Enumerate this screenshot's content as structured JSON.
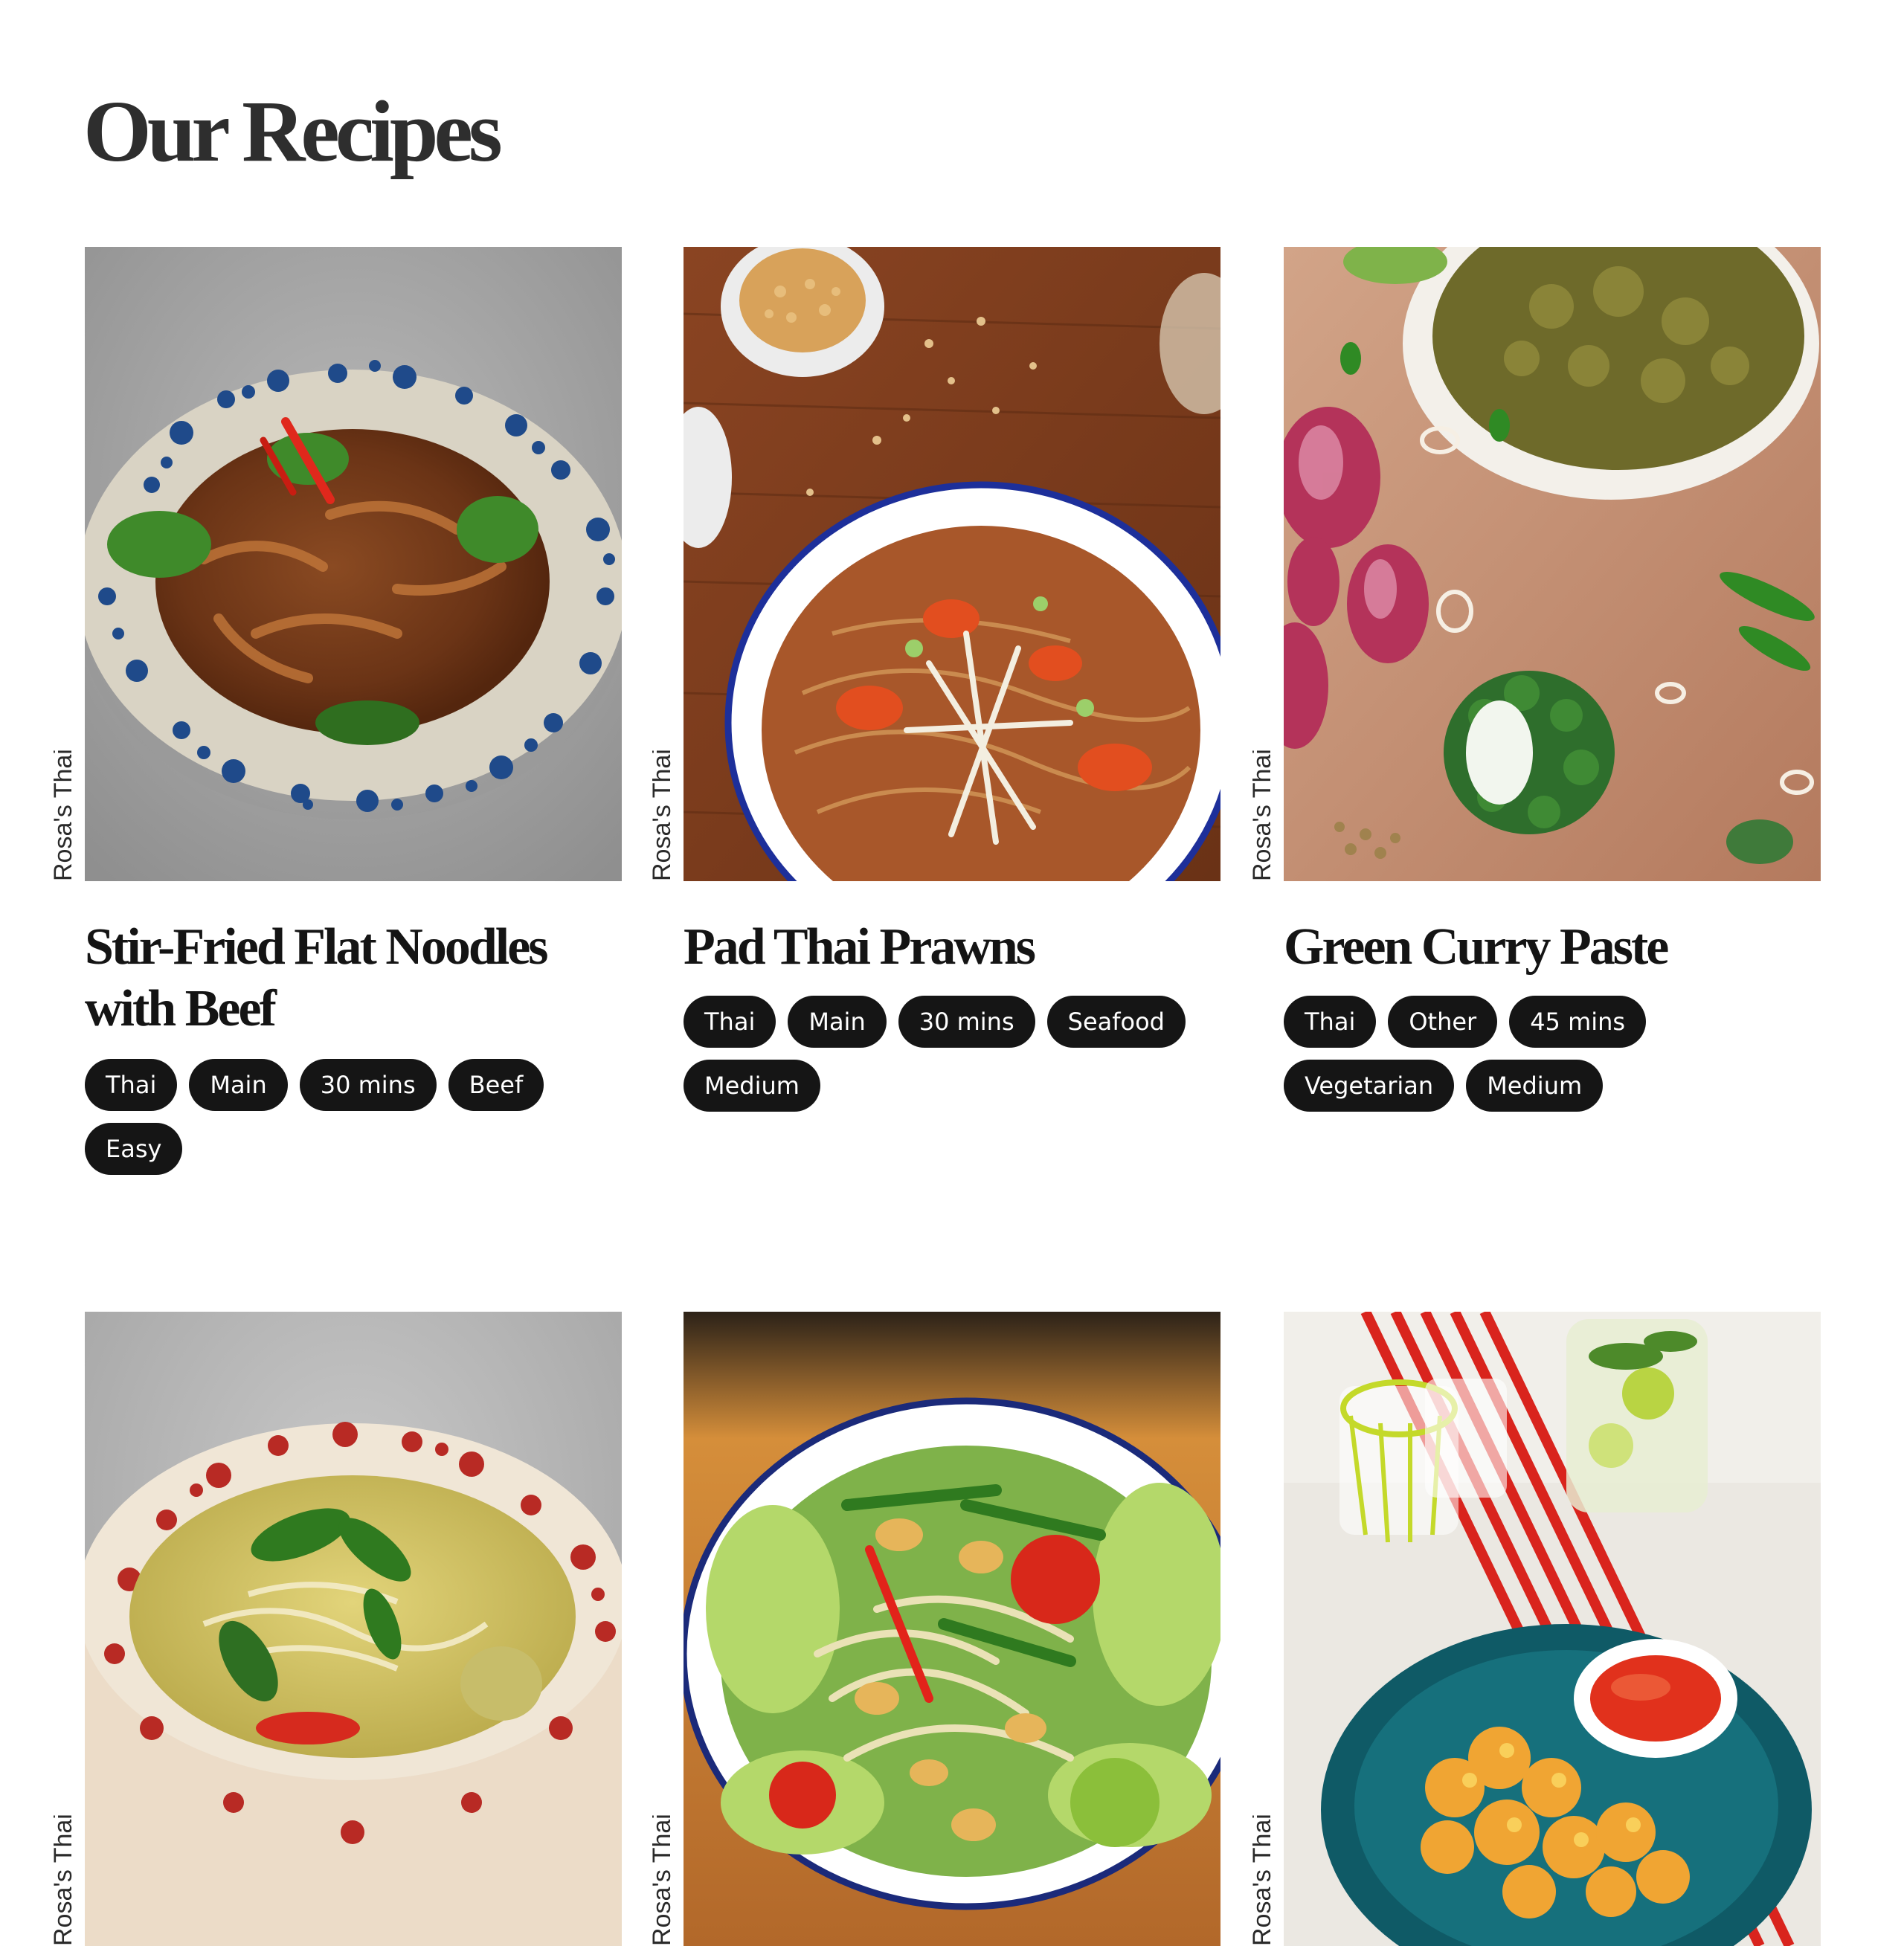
{
  "page": {
    "title": "Our Recipes"
  },
  "recipes": [
    {
      "brand": "Rosa's Thai",
      "title": "Stir-Fried Flat Noodles with Beef",
      "tags": [
        "Thai",
        "Main",
        "30 mins",
        "Beef",
        "Easy"
      ],
      "image_alt": "Stir-fried flat noodles with beef on a blue speckled plate"
    },
    {
      "brand": "Rosa's Thai",
      "title": "Pad Thai Prawns",
      "tags": [
        "Thai",
        "Main",
        "30 mins",
        "Seafood",
        "Medium"
      ],
      "image_alt": "Pad thai with prawns in a white enamel bowl on a wooden table"
    },
    {
      "brand": "Rosa's Thai",
      "title": "Green Curry Paste",
      "tags": [
        "Thai",
        "Other",
        "45 mins",
        "Vegetarian",
        "Medium"
      ],
      "image_alt": "Green curry paste in a bowl with shallots, chillies and kaffir lime"
    },
    {
      "brand": "Rosa's Thai",
      "image_alt": "Green curry noodle soup in a red speckled bowl"
    },
    {
      "brand": "Rosa's Thai",
      "image_alt": "Papaya salad with cashews and tomatoes in a white bowl"
    },
    {
      "brand": "Rosa's Thai",
      "image_alt": "Sweetcorn fritters with sweet chilli sauce on a teal plate"
    }
  ],
  "colors": {
    "tag_background": "#151515",
    "tag_text": "#ffffff",
    "title_text": "#141414",
    "heading_text": "#2e2e2e"
  }
}
